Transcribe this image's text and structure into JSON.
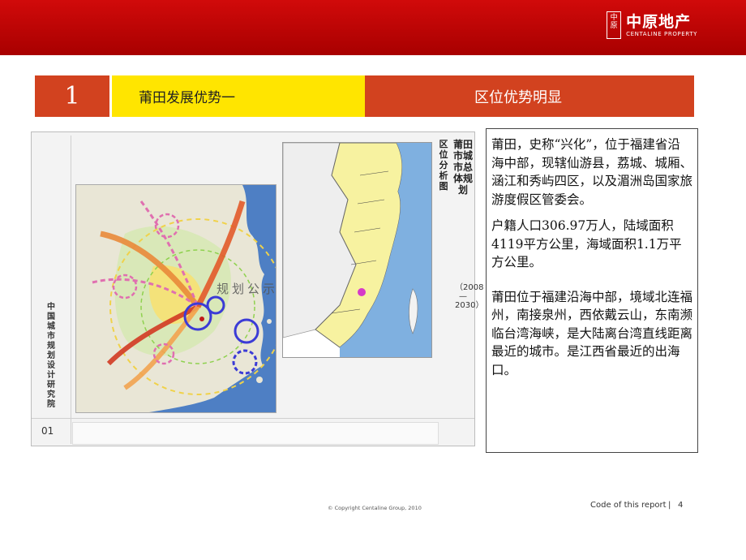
{
  "header": {
    "logo_seal": "中原",
    "logo_cn": "中原地产",
    "logo_en": "CENTALINE PROPERTY",
    "brand_color": "#c00000"
  },
  "title_bar": {
    "number": "1",
    "left_title": "莆田发展优势一",
    "right_title": "区位优势明显",
    "accent_red": "#d2421f",
    "accent_yellow": "#ffe500"
  },
  "figure": {
    "vertical_title": "莆田市城市总体规划",
    "years": "（2008—2030）",
    "subtitle": "区位分析图",
    "institute": "中国城市规划设计研究院",
    "figure_number": "01",
    "watermark": "规划公示"
  },
  "text_panel": {
    "paragraphs": [
      "莆田，史称“兴化”，位于福建省沿海中部，现辖仙游县，荔城、城厢、涵江和秀屿四区，以及湄洲岛国家旅游度假区管委会。",
      "户籍人口306.97万人，陆域面积4119平方公里，海域面积1.1万平方公里。",
      "莆田位于福建沿海中部，境域北连福州，南接泉州，西依戴云山，东南濒临台湾海峡，是大陆离台湾直线距离最近的城市。是江西省最近的出海口。"
    ]
  },
  "footer": {
    "copyright": "© Copyright  Centaline Group, 2010",
    "code_label": "Code of this report",
    "separator": "|",
    "page_number": "4"
  }
}
